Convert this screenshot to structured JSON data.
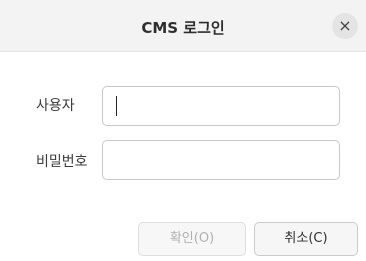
{
  "window": {
    "title": "CMS 로그인",
    "close_glyph": "×"
  },
  "form": {
    "user_label": "사용자",
    "user_value": "",
    "password_label": "비밀번호",
    "password_value": ""
  },
  "buttons": {
    "ok_label": "확인(O)",
    "ok_enabled": false,
    "cancel_label": "취소(C)"
  },
  "icons": {
    "close": "close-icon"
  }
}
